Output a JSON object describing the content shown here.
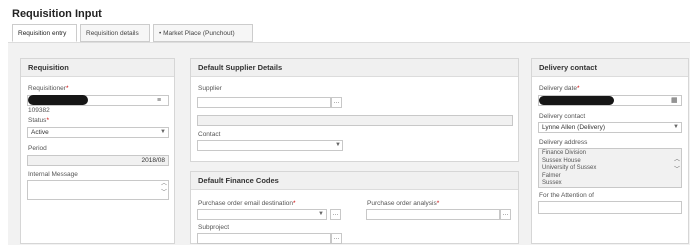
{
  "page": {
    "title": "Requisition Input"
  },
  "tabs": [
    {
      "label": "Requisition entry",
      "active": true
    },
    {
      "label": "Requisition details",
      "active": false
    },
    {
      "label": "Market Place (Punchout)",
      "active": false
    }
  ],
  "requisition_panel": {
    "header": "Requisition",
    "requisitioner_label": "Requisitioner",
    "requisitioner_id": "109382",
    "status_label": "Status",
    "status_value": "Active",
    "period_label": "Period",
    "period_value": "2018/08",
    "internal_message_label": "Internal Message",
    "internal_message_value": ""
  },
  "supplier_panel": {
    "header": "Default Supplier Details",
    "supplier_label": "Supplier",
    "supplier_value": "",
    "supplier_name_value": "",
    "contact_label": "Contact",
    "contact_value": ""
  },
  "finance_panel": {
    "header": "Default Finance Codes",
    "po_email_label": "Purchase order email destination",
    "po_email_value": "",
    "po_analysis_label": "Purchase order analysis",
    "po_analysis_value": "",
    "subproject_label": "Subproject",
    "subproject_value": ""
  },
  "delivery_panel": {
    "header": "Delivery contact",
    "delivery_date_label": "Delivery date",
    "delivery_contact_label": "Delivery contact",
    "delivery_contact_value": "Lynne Allen (Delivery)",
    "delivery_address_label": "Delivery address",
    "address_lines": [
      "Finance Division",
      "Sussex House",
      "University of Sussex",
      "Falmer",
      "Sussex"
    ],
    "attention_label": "For the Attention of",
    "attention_value": ""
  },
  "icons": {
    "lookup": "ellipsis-icon",
    "calendar": "calendar-icon",
    "list": "list-icon",
    "dropdown": "chevron-down-icon"
  },
  "colors": {
    "panel_header_bg": "#f0f0f0",
    "border": "#d6d6d6",
    "required": "#cc0000",
    "redaction": "#161616"
  }
}
